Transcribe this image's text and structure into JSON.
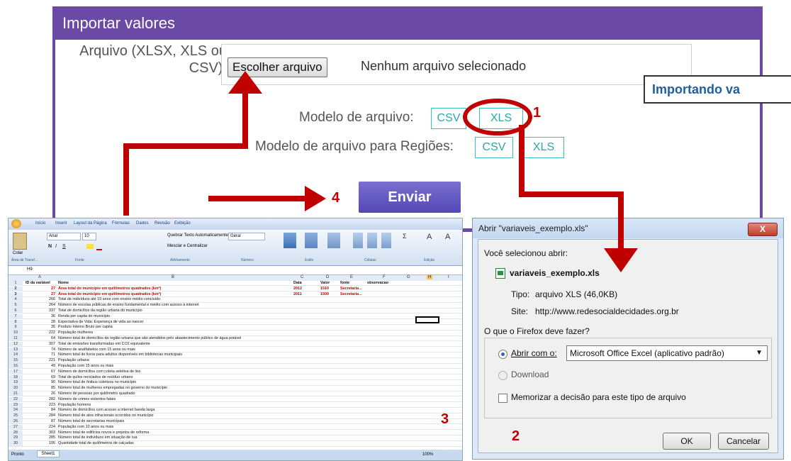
{
  "panel": {
    "title": "Importar valores",
    "file_label": "Arquivo (XLSX, XLS ou CSV):",
    "choose_button": "Escolher arquivo",
    "no_file": "Nenhum arquivo selecionado",
    "model_label": "Modelo de arquivo:",
    "model_region_label": "Modelo de arquivo para Regiões:",
    "csv": "CSV",
    "xls": "XLS",
    "submit": "Enviar"
  },
  "callout": "Importando va",
  "steps": {
    "s1": "1",
    "s2": "2",
    "s3": "3",
    "s4": "4"
  },
  "excel": {
    "tabs": [
      "Início",
      "Inserir",
      "Layout da Página",
      "Fórmulas",
      "Dados",
      "Revisão",
      "Exibição"
    ],
    "font_name": "Arial",
    "font_size": "10",
    "wrap_text": "Quebrar Texto Automaticamente",
    "merge": "Mesclar e Centralizar",
    "number_format": "Geral",
    "paste": "Colar",
    "cell_ref": "H9",
    "group_labels": [
      "Área de Transf...",
      "Fonte",
      "Alinhamento",
      "Número",
      "Estilo",
      "Células",
      "Edição"
    ],
    "col_letters": [
      "A",
      "B",
      "C",
      "D",
      "E",
      "F",
      "G",
      "H",
      "I"
    ],
    "headers": {
      "id": "ID da variável",
      "name": "Nome",
      "data": "Data",
      "valor": "Valor",
      "fonte": "fonte",
      "obs": "observacao"
    },
    "rows": [
      {
        "id": "27",
        "name": "Área total do município em quilômetros quadrados (km²)",
        "data": "2012",
        "valor": "1510",
        "fonte": "Secretaria...",
        "red": true
      },
      {
        "id": "27",
        "name": "Área total do município em quilômetros quadrados (km²)",
        "data": "2011",
        "valor": "1500",
        "fonte": "Secretaria...",
        "red": true
      },
      {
        "id": "266",
        "name": "Total de indivíduos até 19 anos com ensino médio concluído"
      },
      {
        "id": "264",
        "name": "Número de escolas públicas de ensino fundamental e médio com acesso à internet"
      },
      {
        "id": "337",
        "name": "Total de domicílios da região urbana do município"
      },
      {
        "id": "36",
        "name": "Renda per capita do município"
      },
      {
        "id": "28",
        "name": "Expectativa de Vida: Esperança de vida ao nascer"
      },
      {
        "id": "35",
        "name": "Produto Interno Bruto per capita"
      },
      {
        "id": "222",
        "name": "População mulheres"
      },
      {
        "id": "64",
        "name": "Número total de domicílios da região urbana que são atendidos pelo abastecimento público de água potável"
      },
      {
        "id": "307",
        "name": "Total de emissões transformadas em CO2 equivalente"
      },
      {
        "id": "74",
        "name": "Número de analfabetos com 15 anos ou mais"
      },
      {
        "id": "71",
        "name": "Número total de livros para adultos disponíveis em bibliotecas municipais"
      },
      {
        "id": "221",
        "name": "População urbana"
      },
      {
        "id": "49",
        "name": "População com 15 anos ou mais"
      },
      {
        "id": "67",
        "name": "Número de domicílios com coleta seletiva de lixo"
      },
      {
        "id": "69",
        "name": "Total de quilos reciclados de resíduo urbano"
      },
      {
        "id": "90",
        "name": "Número total de ônibus coletivos no município"
      },
      {
        "id": "85",
        "name": "Número total de mulheres empregadas no governo do município"
      },
      {
        "id": "26",
        "name": "Número de pessoas por quilômetro quadrado"
      },
      {
        "id": "282",
        "name": "Número de crimes violentos fatais"
      },
      {
        "id": "223",
        "name": "População homens"
      },
      {
        "id": "84",
        "name": "Número de domicílios com acesso a internet banda larga"
      },
      {
        "id": "284",
        "name": "Número total de atos infracionais ocorridos no município"
      },
      {
        "id": "87",
        "name": "Número total de secretarias municipais"
      },
      {
        "id": "224",
        "name": "População com 10 anos ou mais"
      },
      {
        "id": "303",
        "name": "Número total de edifícios novos e projetos de reforma"
      },
      {
        "id": "285",
        "name": "Número total de indivíduos em situação de rua"
      },
      {
        "id": "106",
        "name": "Quantidade total de quilômetros de calçadas"
      }
    ],
    "sheet_tab": "Sheet1",
    "status": "Pronto",
    "zoom": "100%"
  },
  "dialog": {
    "title": "Abrir \"variaveis_exemplo.xls\"",
    "close": "X",
    "selected_text": "Você selecionou abrir:",
    "filename": "variaveis_exemplo.xls",
    "type_label": "Tipo:",
    "type_value": "arquivo XLS (46,0KB)",
    "site_label": "Site:",
    "site_value": "http://www.redesocialdecidades.org.br",
    "question": "O que o Firefox deve fazer?",
    "open_with": "Abrir com o:",
    "app": "Microsoft Office Excel (aplicativo padrão)",
    "download": "Download",
    "remember": "Memorizar a decisão para este tipo de arquivo",
    "ok": "OK",
    "cancel": "Cancelar"
  },
  "colors": {
    "purple": "#6a4aa5",
    "teal": "#3cbfc0",
    "red_arrow": "#c00000",
    "button_purple": "#5a4fbd"
  }
}
